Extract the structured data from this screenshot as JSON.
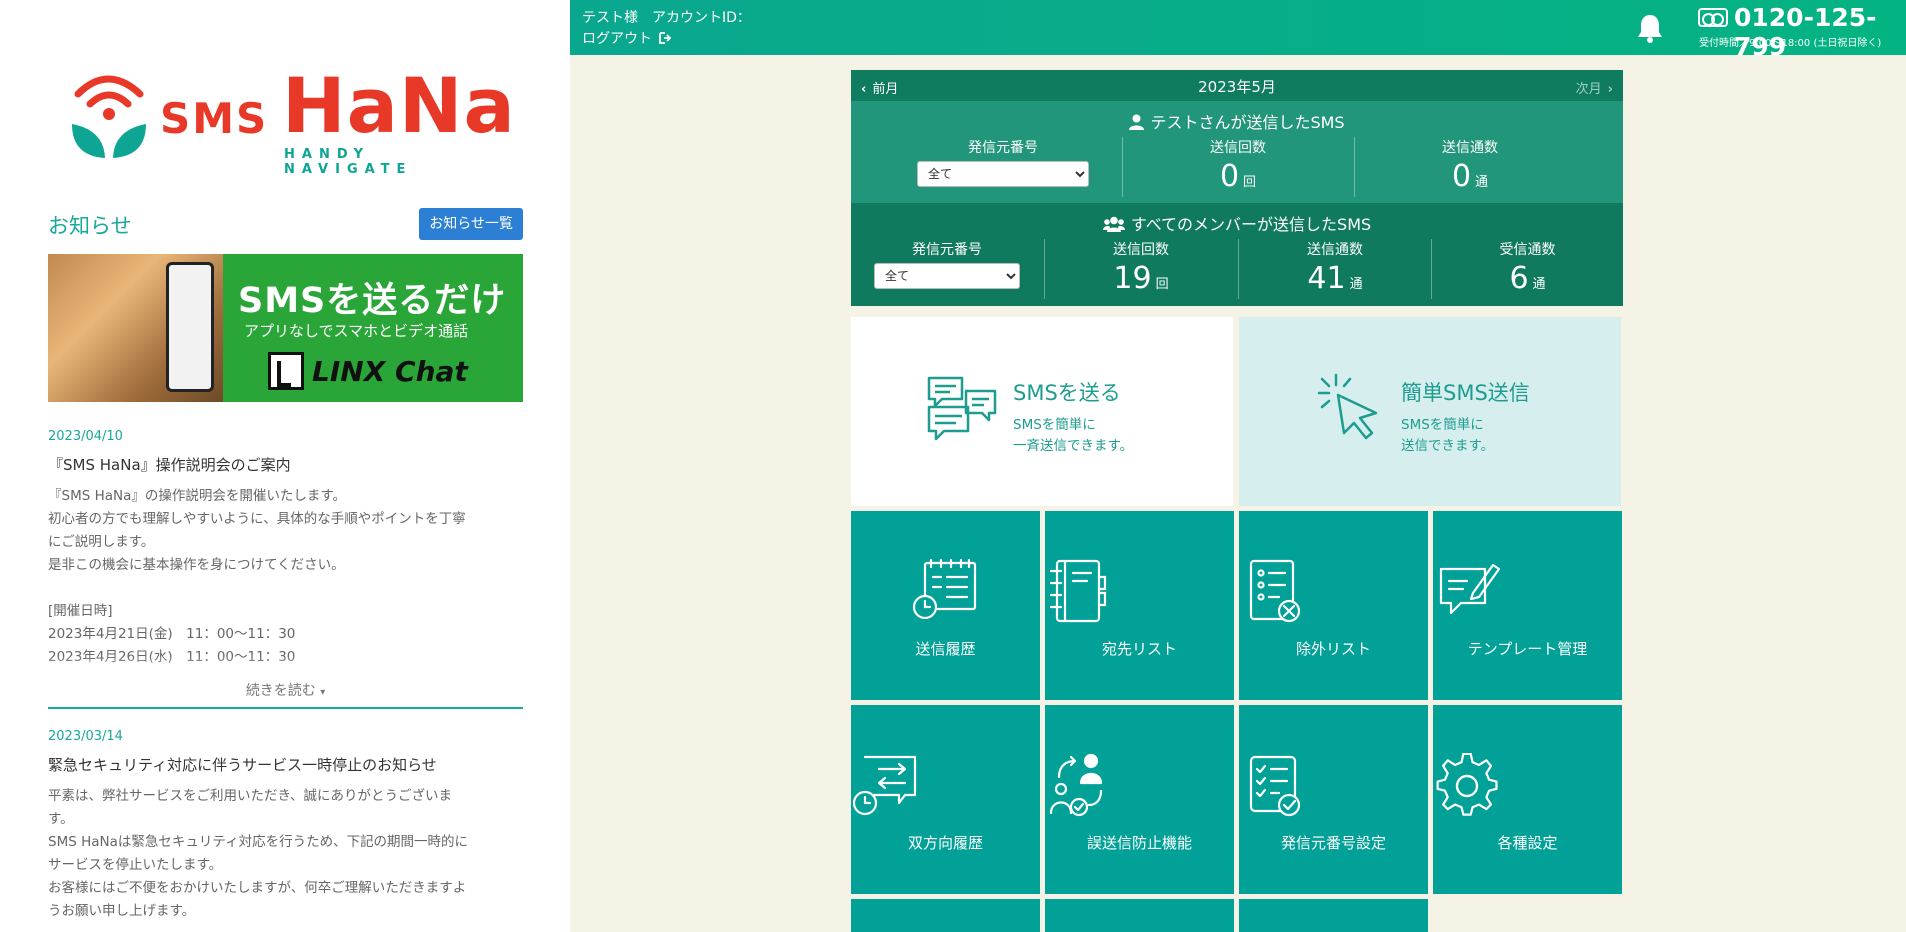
{
  "sidebar": {
    "logo": {
      "sms": "SMS",
      "hana": "HaNa",
      "tagline": "HANDY NAVIGATE"
    },
    "news_title": "お知らせ",
    "news_all_button": "お知らせ一覧",
    "banner": {
      "headline": "SMSを送るだけ",
      "subline": "アプリなしでスマホとビデオ通話",
      "brand": "LINX Chat"
    },
    "posts": [
      {
        "date": "2023/04/10",
        "title": "『SMS HaNa』操作説明会のご案内",
        "lines": [
          "『SMS HaNa』の操作説明会を開催いたします。",
          "初心者の方でも理解しやすいように、具体的な手順やポイントを丁寧",
          "にご説明します。",
          "是非この機会に基本操作を身につけてください。",
          "",
          "[開催日時]",
          "2023年4月21日(金)　11：00〜11：30",
          "2023年4月26日(水)　11：00〜11：30"
        ],
        "read_more": "続きを読む"
      },
      {
        "date": "2023/03/14",
        "title": "緊急セキュリティ対応に伴うサービス一時停止のお知らせ",
        "lines": [
          "平素は、弊社サービスをご利用いただき、誠にありがとうございま",
          "す。",
          "SMS HaNaは緊急セキュリティ対応を行うため、下記の期間一時的に",
          "サービスを停止いたします。",
          "お客様にはご不便をおかけいたしますが、何卒ご理解いただきますよ",
          "うお願い申し上げます。"
        ]
      }
    ]
  },
  "header": {
    "user": "テスト様　アカウントID：",
    "logout": "ログアウト",
    "tel": "0120-125-799",
    "hours": "受付時間／9:00〜18:00 (土日祝日除く)"
  },
  "calendar": {
    "prev": "前月",
    "month": "2023年5月",
    "next": "次月"
  },
  "my_sms": {
    "title": "テストさんが送信したSMS",
    "sender_label": "発信元番号",
    "sender_value": "全て",
    "sends_label": "送信回数",
    "sends_value": "0",
    "sends_unit": "回",
    "msgs_label": "送信通数",
    "msgs_value": "0",
    "msgs_unit": "通"
  },
  "all_sms": {
    "title": "すべてのメンバーが送信したSMS",
    "sender_label": "発信元番号",
    "sender_value": "全て",
    "sends_label": "送信回数",
    "sends_value": "19",
    "sends_unit": "回",
    "msgs_label": "送信通数",
    "msgs_value": "41",
    "msgs_unit": "通",
    "recv_label": "受信通数",
    "recv_value": "6",
    "recv_unit": "通"
  },
  "tiles": {
    "send_sms": {
      "title": "SMSを送る",
      "desc1": "SMSを簡単に",
      "desc2": "一斉送信できます。"
    },
    "easy_sms": {
      "title": "簡単SMS送信",
      "desc1": "SMSを簡単に",
      "desc2": "送信できます。"
    },
    "menu": [
      {
        "label": "送信履歴",
        "icon": "history-icon"
      },
      {
        "label": "宛先リスト",
        "icon": "address-book-icon"
      },
      {
        "label": "除外リスト",
        "icon": "exclude-list-icon"
      },
      {
        "label": "テンプレート管理",
        "icon": "template-icon"
      },
      {
        "label": "双方向履歴",
        "icon": "two-way-history-icon"
      },
      {
        "label": "誤送信防止機能",
        "icon": "prevention-icon"
      },
      {
        "label": "発信元番号設定",
        "icon": "sender-setting-icon"
      },
      {
        "label": "各種設定",
        "icon": "gear-icon"
      }
    ]
  },
  "colors": {
    "accent": "#02a198",
    "brand_red": "#e83828",
    "header_green": "#04b382",
    "stats_dark": "#107a5e",
    "stats_mid": "#22967a"
  }
}
